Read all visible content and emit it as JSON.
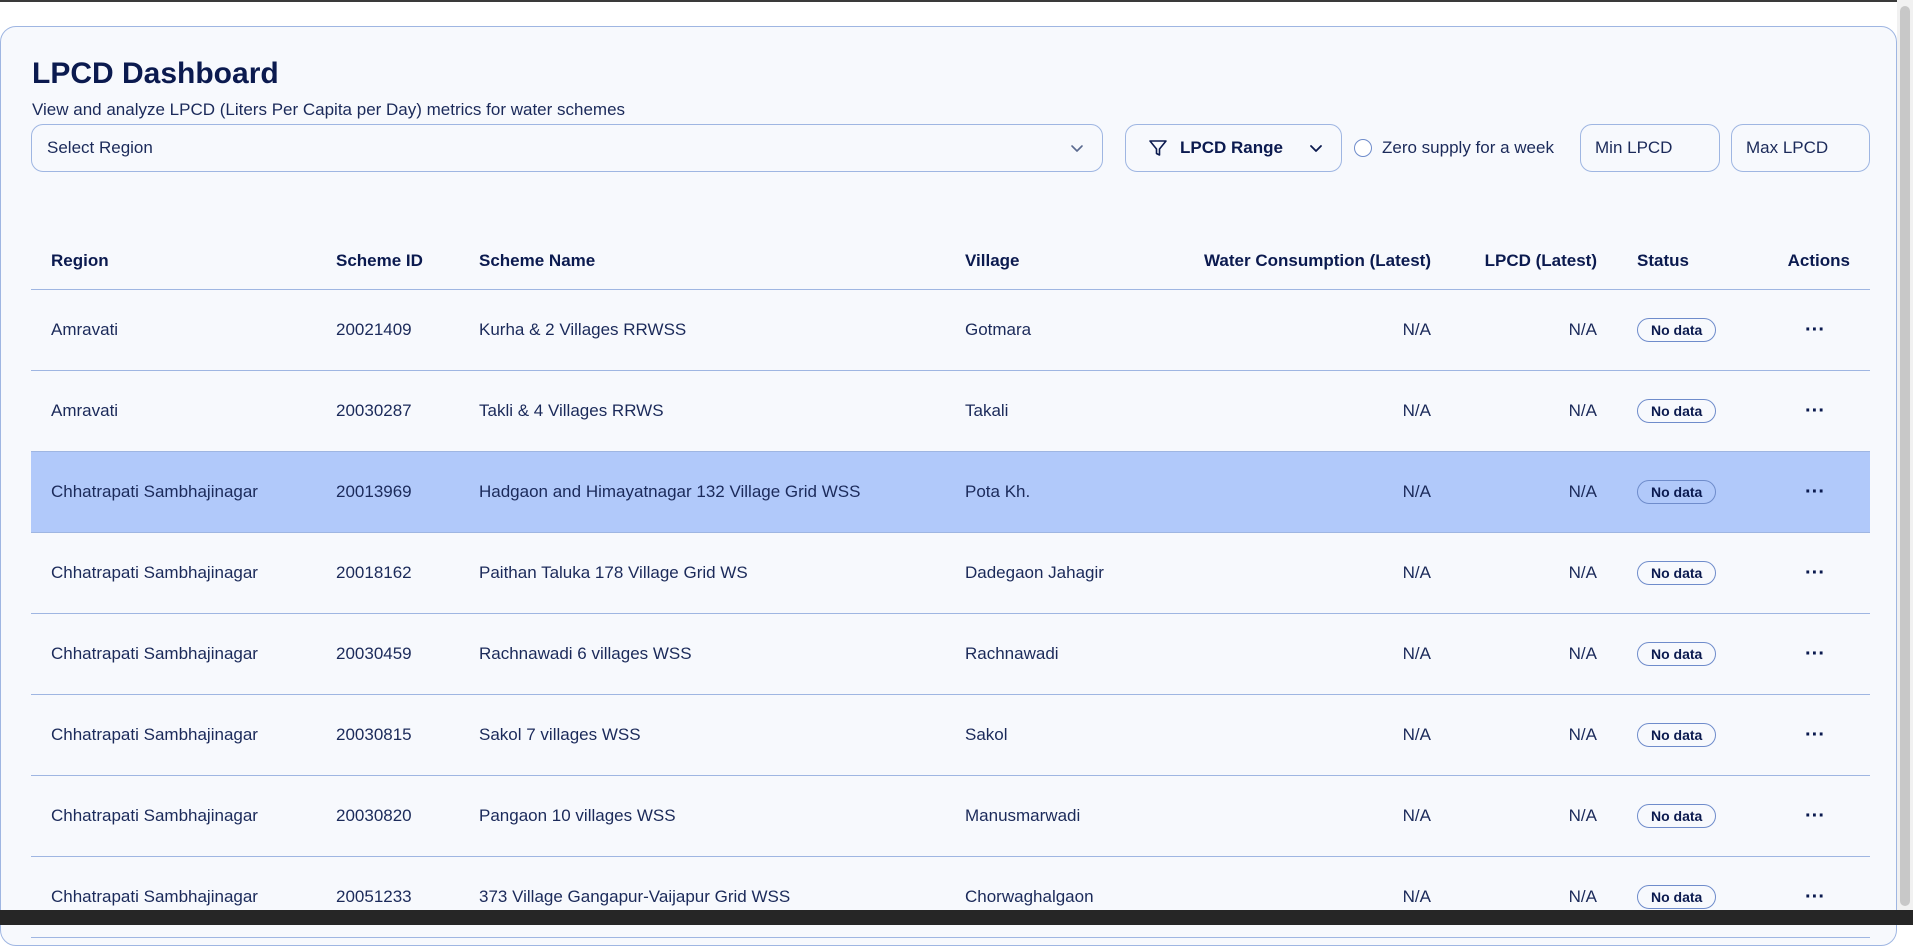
{
  "header": {
    "title": "LPCD Dashboard",
    "subtitle": "View and analyze LPCD (Liters Per Capita per Day) metrics for water schemes"
  },
  "filters": {
    "region_placeholder": "Select Region",
    "lpcd_range_label": "LPCD Range",
    "zero_supply_label": "Zero supply for a week",
    "zero_supply_checked": false,
    "min_placeholder": "Min LPCD",
    "max_placeholder": "Max LPCD"
  },
  "table": {
    "columns": {
      "region": "Region",
      "scheme_id": "Scheme ID",
      "scheme_name": "Scheme Name",
      "village": "Village",
      "water": "Water Consumption (Latest)",
      "lpcd": "LPCD (Latest)",
      "status": "Status",
      "actions": "Actions"
    },
    "rows": [
      {
        "region": "Amravati",
        "scheme_id": "20021409",
        "scheme_name": "Kurha & 2 Villages RRWSS",
        "village": "Gotmara",
        "water": "N/A",
        "lpcd": "N/A",
        "status": "No data",
        "actions": "···"
      },
      {
        "region": "Amravati",
        "scheme_id": "20030287",
        "scheme_name": "Takli & 4 Villages RRWS",
        "village": "Takali",
        "water": "N/A",
        "lpcd": "N/A",
        "status": "No data",
        "actions": "···"
      },
      {
        "region": "Chhatrapati Sambhajinagar",
        "scheme_id": "20013969",
        "scheme_name": "Hadgaon and Himayatnagar 132 Village Grid WSS",
        "village": "Pota Kh.",
        "water": "N/A",
        "lpcd": "N/A",
        "status": "No data",
        "actions": "···"
      },
      {
        "region": "Chhatrapati Sambhajinagar",
        "scheme_id": "20018162",
        "scheme_name": "Paithan Taluka 178 Village Grid WS",
        "village": "Dadegaon Jahagir",
        "water": "N/A",
        "lpcd": "N/A",
        "status": "No data",
        "actions": "···"
      },
      {
        "region": "Chhatrapati Sambhajinagar",
        "scheme_id": "20030459",
        "scheme_name": "Rachnawadi 6 villages WSS",
        "village": "Rachnawadi",
        "water": "N/A",
        "lpcd": "N/A",
        "status": "No data",
        "actions": "···"
      },
      {
        "region": "Chhatrapati Sambhajinagar",
        "scheme_id": "20030815",
        "scheme_name": "Sakol 7 villages WSS",
        "village": "Sakol",
        "water": "N/A",
        "lpcd": "N/A",
        "status": "No data",
        "actions": "···"
      },
      {
        "region": "Chhatrapati Sambhajinagar",
        "scheme_id": "20030820",
        "scheme_name": "Pangaon 10 villages WSS",
        "village": "Manusmarwadi",
        "water": "N/A",
        "lpcd": "N/A",
        "status": "No data",
        "actions": "···"
      },
      {
        "region": "Chhatrapati Sambhajinagar",
        "scheme_id": "20051233",
        "scheme_name": "373 Village Gangapur-Vaijapur Grid WSS",
        "village": "Chorwaghalgaon",
        "water": "N/A",
        "lpcd": "N/A",
        "status": "No data",
        "actions": "···"
      }
    ],
    "selected_row_index": 2
  },
  "colors": {
    "text_primary": "#0b1a4f",
    "border": "#9fb6e2",
    "background": "#f7f9fd",
    "selected_row": "#b1c9fa"
  },
  "icons": {
    "region_chevron": "chevron-down-icon",
    "range_filter": "filter-icon",
    "range_chevron": "chevron-down-icon",
    "row_actions": "more-horizontal-icon"
  }
}
